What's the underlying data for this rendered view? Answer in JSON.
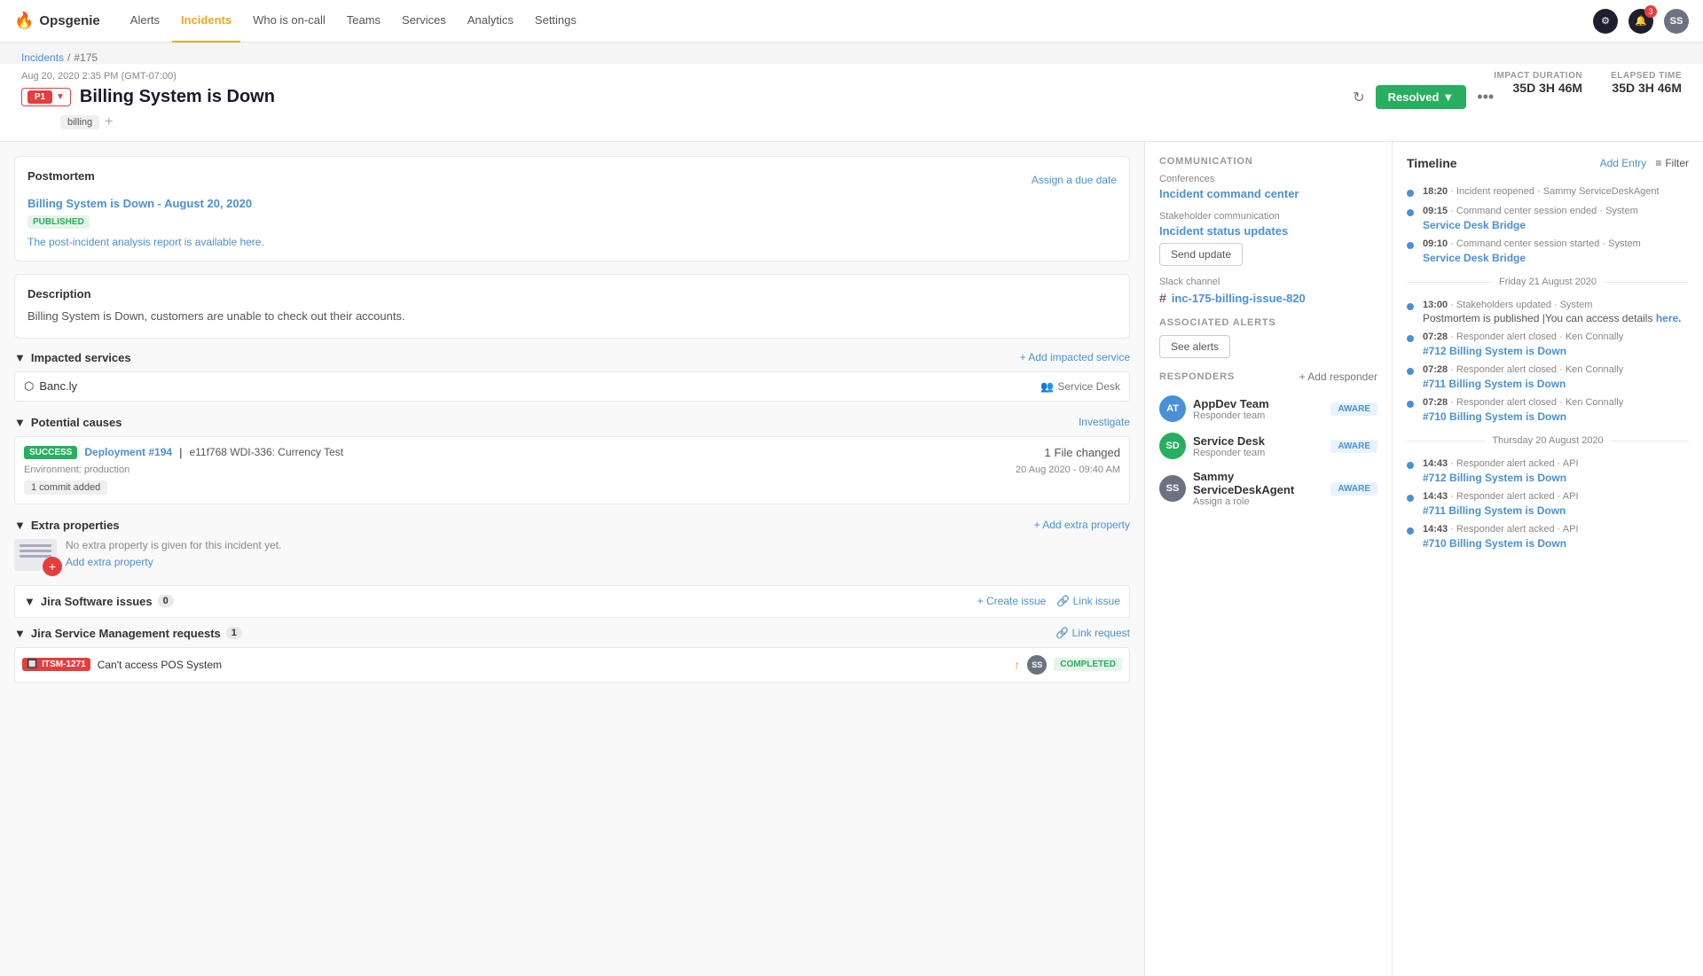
{
  "app": {
    "name": "Opsgenie",
    "logo_icon": "🔥"
  },
  "nav": {
    "items": [
      {
        "label": "Alerts",
        "active": false
      },
      {
        "label": "Incidents",
        "active": true
      },
      {
        "label": "Who is on-call",
        "active": false
      },
      {
        "label": "Teams",
        "active": false
      },
      {
        "label": "Services",
        "active": false
      },
      {
        "label": "Analytics",
        "active": false
      },
      {
        "label": "Settings",
        "active": false
      }
    ],
    "notification_count": "3",
    "avatar_initials": "SS"
  },
  "breadcrumb": {
    "parent": "Incidents",
    "current": "#175"
  },
  "incident": {
    "priority": "P1",
    "date": "Aug 20, 2020 2:35 PM (GMT-07:00)",
    "title": "Billing System is Down",
    "tag": "billing",
    "status": "Resolved",
    "impact_duration_label": "IMPACT DURATION",
    "impact_duration_value": "35D 3H 46M",
    "elapsed_time_label": "ELAPSED TIME",
    "elapsed_time_value": "35D 3H 46M"
  },
  "postmortem": {
    "section_title": "Postmortem",
    "assign_due": "Assign a due date",
    "link_text": "Billing System is Down - August 20, 2020",
    "status_badge": "PUBLISHED",
    "description_link": "The post-incident analysis report is available here."
  },
  "description": {
    "title": "Description",
    "text": "Billing System is Down, customers are unable to check out their accounts."
  },
  "impacted_services": {
    "title": "Impacted services",
    "add_label": "+ Add impacted service",
    "services": [
      {
        "name": "Banc.ly",
        "team": "Service Desk"
      }
    ]
  },
  "potential_causes": {
    "title": "Potential causes",
    "investigate_label": "Investigate",
    "deployment": {
      "status": "SUCCESS",
      "id": "Deployment #194",
      "description": "e11f768 WDI-336: Currency Test",
      "files_changed": "1",
      "files_label": "File changed",
      "date": "20 Aug 2020 - 09:40 AM",
      "environment": "Environment: production",
      "commit": "1 commit added"
    }
  },
  "extra_properties": {
    "title": "Extra properties",
    "add_label": "+ Add extra property",
    "empty_text": "No extra property is given for this incident yet.",
    "add_link": "Add extra property"
  },
  "jira_issues": {
    "title": "Jira Software issues",
    "count": "0",
    "create_label": "+ Create issue",
    "link_label": "🔗 Link issue"
  },
  "jira_service": {
    "title": "Jira Service Management requests",
    "count": "1",
    "link_label": "🔗 Link request",
    "requests": [
      {
        "id": "ITSM-1271",
        "title": "Can't access POS System",
        "status": "COMPLETED"
      }
    ]
  },
  "communication": {
    "section_label": "COMMUNICATION",
    "conferences_label": "Conferences",
    "conference_link": "Incident command center",
    "stakeholder_label": "Stakeholder communication",
    "stakeholder_link": "Incident status updates",
    "send_update_label": "Send update",
    "slack_label": "Slack channel",
    "slack_channel": "inc-175-billing-issue-820"
  },
  "associated_alerts": {
    "section_label": "ASSOCIATED ALERTS",
    "see_alerts_label": "See alerts"
  },
  "responders": {
    "section_label": "RESPONDERS",
    "add_label": "+ Add responder",
    "items": [
      {
        "name": "AppDev Team",
        "role": "Responder team",
        "status": "AWARE",
        "initials": "AT",
        "color": "#4a90d9"
      },
      {
        "name": "Service Desk",
        "role": "Responder team",
        "status": "AWARE",
        "initials": "SD",
        "color": "#27ae60"
      },
      {
        "name": "Sammy ServiceDeskAgent",
        "role": "Assign a role",
        "status": "AWARE",
        "initials": "SS",
        "color": "#6b7280"
      }
    ]
  },
  "timeline": {
    "title": "Timeline",
    "add_entry": "Add Entry",
    "filter": "Filter",
    "entries": [
      {
        "time": "18:20",
        "text": "Incident reopened · Sammy ServiceDeskAgent",
        "link": null,
        "dot": "blue"
      },
      {
        "time": "09:15",
        "text": "Command center session ended · System",
        "link": "Service Desk Bridge",
        "dot": "blue"
      },
      {
        "time": "09:10",
        "text": "Command center session started · System",
        "link": "Service Desk Bridge",
        "dot": "blue"
      },
      {
        "divider": "Friday 21 August 2020"
      },
      {
        "time": "13:00",
        "text": "Stakeholders updated · System",
        "link": null,
        "extra": "Postmortem is published |You can access details",
        "extra_link": "here.",
        "dot": "blue"
      },
      {
        "time": "07:28",
        "text": "Responder alert closed · Ken Connally",
        "link": "#712 Billing System is Down",
        "dot": "blue"
      },
      {
        "time": "07:28",
        "text": "Responder alert closed · Ken Connally",
        "link": "#711 Billing System is Down",
        "dot": "blue"
      },
      {
        "time": "07:28",
        "text": "Responder alert closed · Ken Connally",
        "link": "#710 Billing System is Down",
        "dot": "blue"
      },
      {
        "divider": "Thursday 20 August 2020"
      },
      {
        "time": "14:43",
        "text": "Responder alert acked · API",
        "link": "#712 Billing System is Down",
        "dot": "blue"
      },
      {
        "time": "14:43",
        "text": "Responder alert acked · API",
        "link": "#711 Billing System is Down",
        "dot": "blue"
      },
      {
        "time": "14:43",
        "text": "Responder alert acked · API",
        "link": "#710 Billing System is Down",
        "dot": "blue"
      }
    ]
  }
}
